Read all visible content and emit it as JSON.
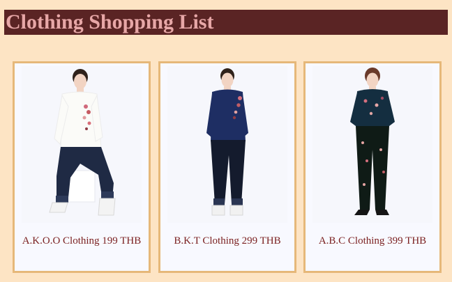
{
  "header": {
    "title": "Clothing Shopping List"
  },
  "products": [
    {
      "caption": "A.K.O.O Clothing 199 THB",
      "image": "woman-white-floral-sweater-jeans-photo"
    },
    {
      "caption": "B.K.T Clothing 299 THB",
      "image": "woman-navy-floral-sweater-jeans-photo"
    },
    {
      "caption": "A.B.C Clothing 399 THB",
      "image": "woman-floral-blouse-floral-pants-photo"
    }
  ],
  "colors": {
    "page_background": "#fde4c4",
    "title_bar": "#5a2424",
    "title_text": "#e7a7a7",
    "card_border": "#e6b879",
    "caption_text": "#7a1f1f"
  }
}
